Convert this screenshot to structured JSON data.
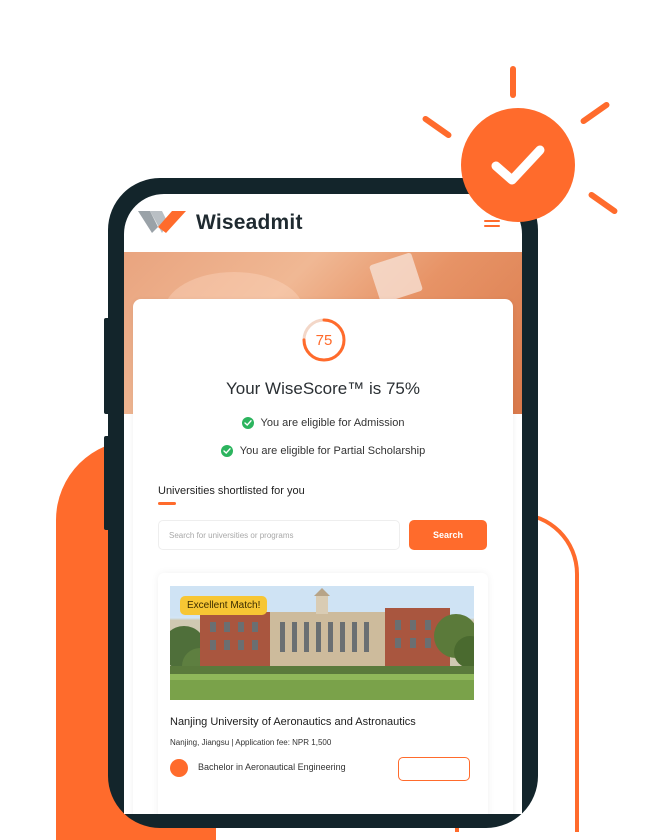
{
  "brand": {
    "name": "Wiseadmit",
    "accent_color": "#FF6B2C",
    "logo_icon": "wiseadmit-logo-icon"
  },
  "score": {
    "value": 75,
    "title": "Your WiseScore™ is 75%"
  },
  "eligibility": [
    {
      "text": "You are eligible for Admission",
      "icon": "check-circle-icon"
    },
    {
      "text": "You are eligible for Partial Scholarship",
      "icon": "check-circle-icon"
    }
  ],
  "shortlist": {
    "title": "Universities shortlisted for you",
    "search_placeholder": "Search for universities or programs",
    "search_label": "Search"
  },
  "university": {
    "badge": "Excellent Match!",
    "name": "Nanjing University of Aeronautics and Astronautics",
    "meta": "Nanjing, Jiangsu | Application fee: NPR 1,500",
    "program": "Bachelor in Aeronautical Engineering"
  }
}
